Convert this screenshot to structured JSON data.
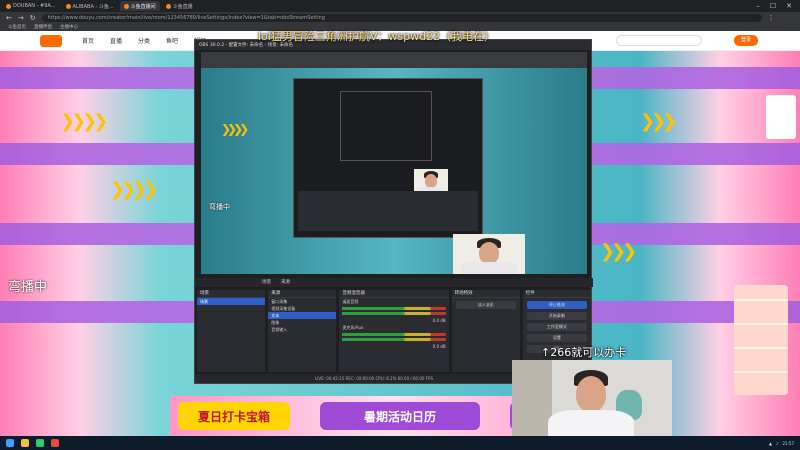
{
  "browser": {
    "tabs": [
      {
        "label": "DOUBAN - #9A...",
        "active": false
      },
      {
        "label": "ALIBABA - 斗鱼...",
        "active": false
      },
      {
        "label": "斗鱼直播间",
        "active": true
      },
      {
        "label": "斗鱼直播",
        "active": false
      }
    ],
    "url": "https://www.douyu.com/creator/main/live/room/123456789/liveSettings/index?view=1&tab=obsStreamSetting"
  },
  "bookmarks": [
    "斗鱼首页",
    "直播伴侣",
    "主播中心"
  ],
  "site": {
    "nav": [
      "首页",
      "直播",
      "分类",
      "鱼吧",
      "视频"
    ],
    "login_label": "登录"
  },
  "overlay": {
    "title": "lol猛男冒险三角洲护航V：wspwd22（我电在）",
    "left_status": "弯播中",
    "inner_status": "弯播中",
    "webcam_caption": "↑266就可以办卡"
  },
  "banner": {
    "btn1": "夏日打卡宝箱",
    "btn2": "暑期活动日历",
    "btn3": "同⊙"
  },
  "obs": {
    "title": "OBS 30.0.2 - 配置文件: 未命名 - 场景: 未命名",
    "tabs": [
      "场景",
      "来源",
      "混音器",
      "转场",
      "控件"
    ],
    "scenes_header": "场景",
    "scenes": [
      "场景"
    ],
    "sources_header": "来源",
    "sources": [
      "窗口采集",
      "视频采集设备",
      "文本",
      "图像",
      "音频输入"
    ],
    "mixer_header": "音频混音器",
    "mixer": [
      {
        "name": "桌面音频",
        "db": "0.0 dB"
      },
      {
        "name": "麦克风/Aux",
        "db": "0.0 dB"
      }
    ],
    "transitions_header": "转场特效",
    "transition_value": "淡入淡出",
    "controls_header": "控件",
    "controls": [
      "停止推流",
      "开始录制",
      "工作室模式",
      "设置",
      "退出"
    ],
    "status": "LIVE: 00:42:15   REC: 00:00:00   CPU: 8.2%   60.00 / 60.00 FPS"
  },
  "taskbar": {
    "clock": "21:57"
  },
  "colors": {
    "accent": "#ff6a00",
    "title_yellow": "#ffe45a",
    "obs_select": "#2f5fc4"
  }
}
